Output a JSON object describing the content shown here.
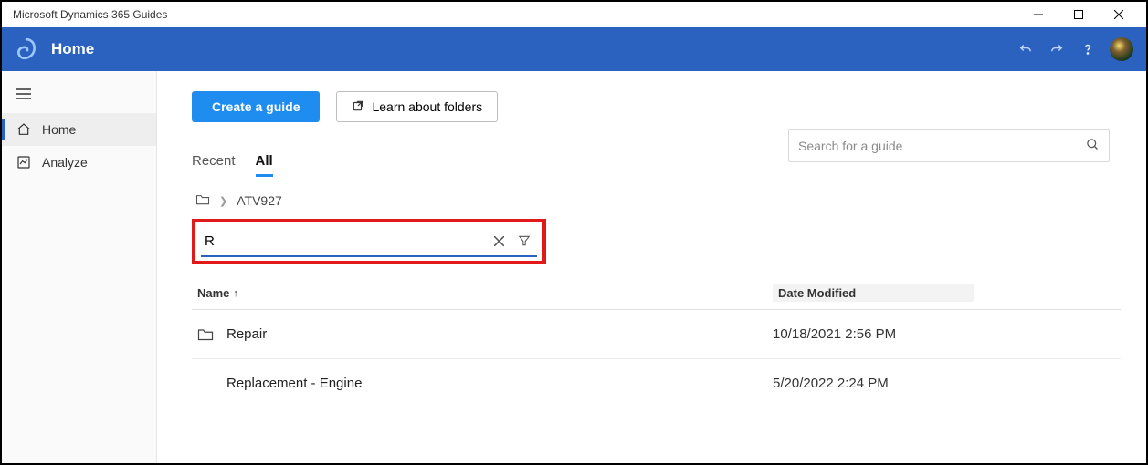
{
  "window": {
    "title": "Microsoft Dynamics 365 Guides"
  },
  "ribbon": {
    "title": "Home"
  },
  "sidebar": {
    "items": [
      {
        "label": "Home",
        "active": true
      },
      {
        "label": "Analyze",
        "active": false
      }
    ]
  },
  "actions": {
    "create_label": "Create a guide",
    "learn_label": "Learn about folders"
  },
  "search": {
    "placeholder": "Search for a guide"
  },
  "tabs": {
    "recent": "Recent",
    "all": "All"
  },
  "breadcrumb": {
    "current": "ATV927"
  },
  "filter": {
    "value": "R"
  },
  "columns": {
    "name": "Name",
    "date_modified": "Date Modified"
  },
  "rows": [
    {
      "type": "folder",
      "name": "Repair",
      "date": "10/18/2021 2:56 PM"
    },
    {
      "type": "guide",
      "name": "Replacement - Engine",
      "date": "5/20/2022 2:24 PM"
    }
  ]
}
